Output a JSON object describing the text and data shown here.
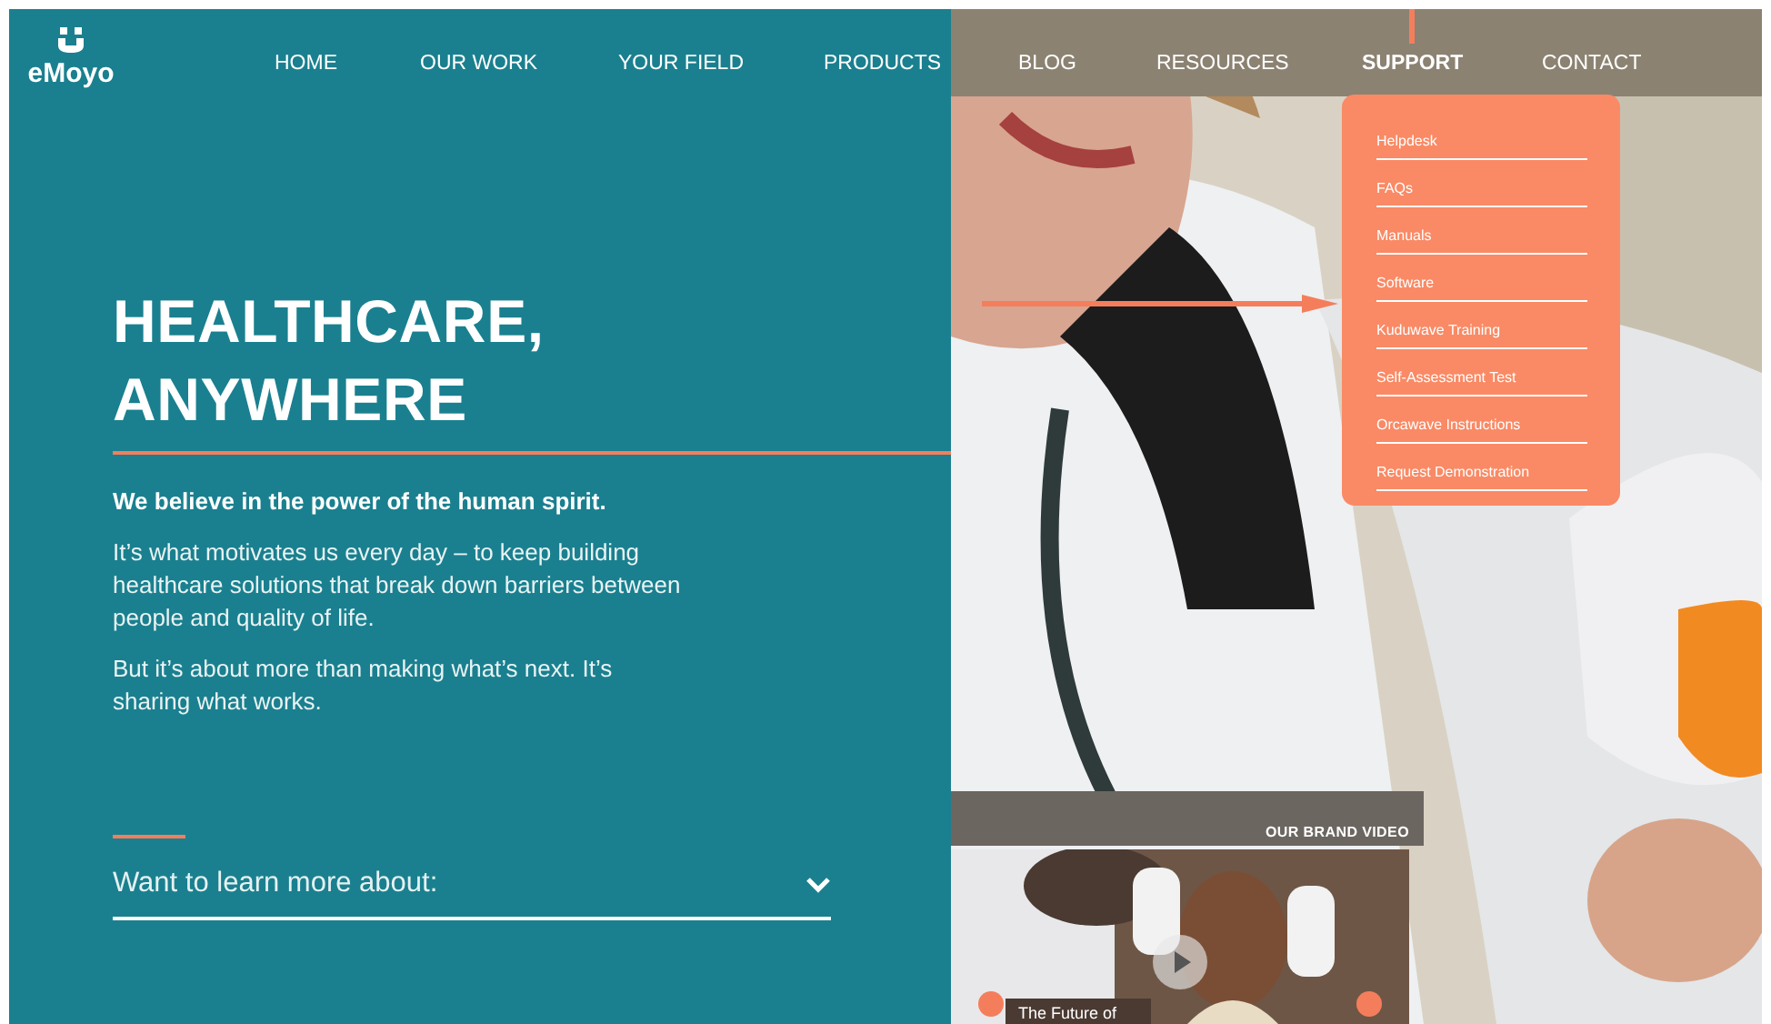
{
  "logo": {
    "text": "eMoyo"
  },
  "nav": [
    {
      "label": "HOME",
      "selected": false
    },
    {
      "label": "OUR WORK",
      "selected": false
    },
    {
      "label": "YOUR FIELD",
      "selected": false
    },
    {
      "label": "PRODUCTS",
      "selected": false
    },
    {
      "label": "BLOG",
      "selected": false
    },
    {
      "label": "RESOURCES",
      "selected": false
    },
    {
      "label": "SUPPORT",
      "selected": true
    },
    {
      "label": "CONTACT",
      "selected": false
    }
  ],
  "support_menu": [
    "Helpdesk",
    "FAQs",
    "Manuals",
    "Software",
    "Kuduwave Training",
    "Self-Assessment Test",
    "Orcawave Instructions",
    "Request Demonstration"
  ],
  "hero": {
    "heading": [
      "HEALTHCARE,",
      "ANYWHERE"
    ],
    "lead": "We believe in the power of the human spirit.",
    "paragraphs": [
      "It’s what motivates us every day – to keep building healthcare solutions that break down barriers between people and quality of life.",
      "But it’s about more than making what’s next. It’s sharing what works."
    ],
    "learn_more": {
      "placeholder": "Want to learn more about:"
    }
  },
  "video": {
    "label": "OUR BRAND VIDEO",
    "caption": "The Future of"
  }
}
